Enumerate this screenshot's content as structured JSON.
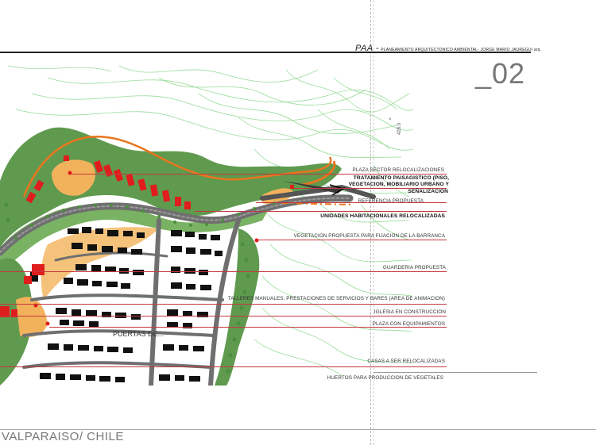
{
  "header": {
    "project_code": "PAA -",
    "project_subtitle": "PLANEAMIENTO ARQUITECTONICO AMBIENTAL- JORGE MARIO JAUREGUI arq."
  },
  "page_number": "_02",
  "city": "VALPARAISO/ CHILE",
  "map": {
    "elevation_label": "428.0",
    "north_mark": "×",
    "neighborhood_label": "PUERTAS DE..."
  },
  "legend": [
    {
      "text": "PLAZA SECTOR RELOCALIZACIONES",
      "bold": false
    },
    {
      "text": "TRATAMIENTO PAISAGISTICO (PISO,",
      "bold": true
    },
    {
      "text": "VEGETACION, MOBILIARIO URBANO Y",
      "bold": true
    },
    {
      "text": "SEÑALIZACION",
      "bold": true
    },
    {
      "text": "REFERENCIA PROPUESTA",
      "bold": false
    },
    {
      "text": "UNIDADES HABITACIONALES RELOCALIZADAS",
      "bold": true
    },
    {
      "text": "VEGETACION PROPUESTA PARA FIJACION DE LA BARRANCA",
      "bold": false
    },
    {
      "text": "GUARDERIA PROPUESTA",
      "bold": false
    },
    {
      "text": "TALLERES MANUALES, PRESTACIONES DE SERVICIOS Y BARES (AREA DE ANIMACION)",
      "bold": false
    },
    {
      "text": "IGLESIA EN CONSTRUCCION",
      "bold": false
    },
    {
      "text": "PLAZA CON EQUIPAMIENTOS",
      "bold": false
    },
    {
      "text": "CASAS A SER RELOCALIZADAS",
      "bold": false
    },
    {
      "text": "HUERTOS PARA PRODUCCION DE VEGETALES",
      "bold": false
    }
  ],
  "colors": {
    "vegetation": "#5f9a4f",
    "contour": "#7fcf7f",
    "road": "#6f6f6f",
    "building": "#111111",
    "relocated": "#e01d1d",
    "plaza": "#f2b25c",
    "leader": "#c5383e",
    "orange_path": "#e8761e"
  }
}
